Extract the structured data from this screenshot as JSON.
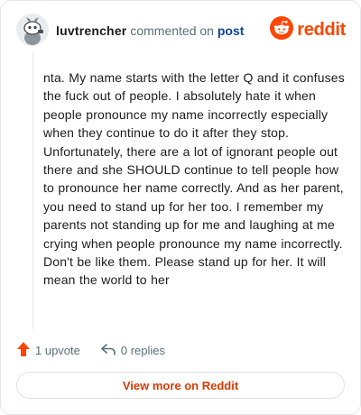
{
  "header": {
    "username": "luvtrencher",
    "commented_on": "commented on",
    "post_link": "post",
    "brand_name": "reddit",
    "brand_color": "#ff4500"
  },
  "comment": {
    "text": "nta. My name starts with the letter Q and it confuses the fuck out of people. I absolutely hate it when people pronounce my name incorrectly especially when they continue to do it after they stop. Unfortunately, there are a lot of ignorant people out there and she SHOULD continue to tell people how to pronounce her name correctly. And as her parent, you need to stand up for her too. I remember my parents not standing up for me and laughing at me crying when people pronounce my name incorrectly. Don't be like them. Please stand up for her. It will mean the world to her"
  },
  "actions": {
    "upvotes": "1 upvote",
    "replies": "0 replies"
  },
  "cta": {
    "label": "View more on Reddit"
  },
  "icons": {
    "avatar": "snoo-avatar-icon",
    "brand": "reddit-logo-icon",
    "upvote": "upvote-arrow-icon",
    "reply": "reply-arrow-icon"
  }
}
